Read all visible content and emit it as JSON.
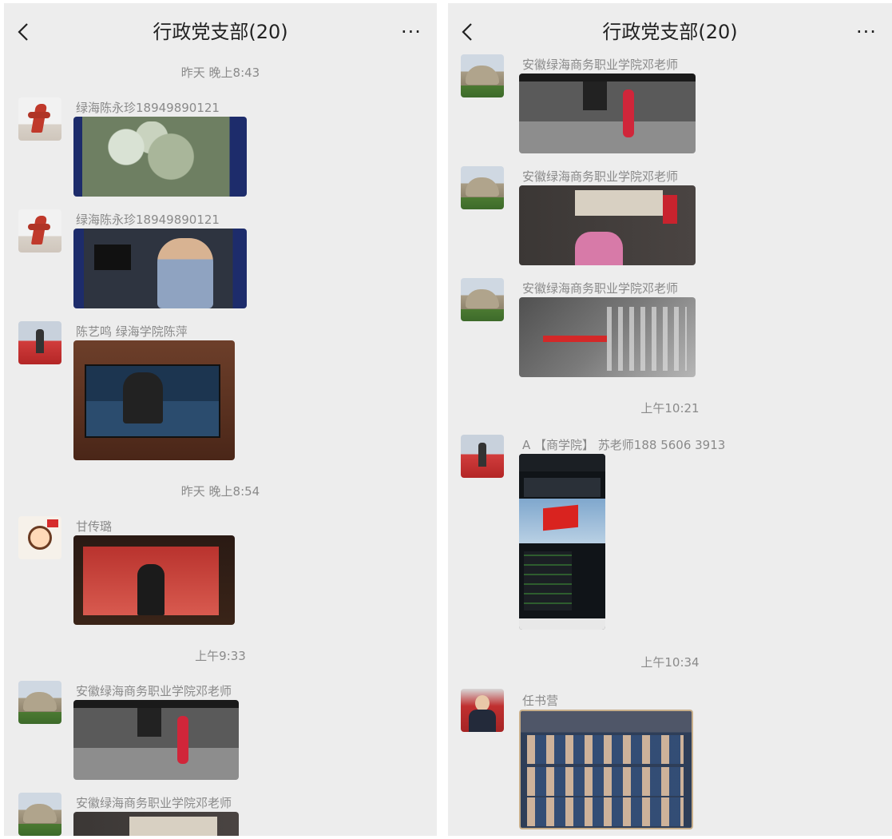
{
  "left": {
    "header": {
      "title": "行政党支部(20)",
      "more": "···"
    },
    "messages": [
      {
        "type": "time",
        "text": "昨天 晚上8:43"
      },
      {
        "type": "msg",
        "sender": "绿海陈永珍18949890121",
        "avatar": "sculpture-avatar",
        "media": "video-thumbnail"
      },
      {
        "type": "msg",
        "sender": "绿海陈永珍18949890121",
        "avatar": "sculpture-avatar",
        "media": "video-thumbnail"
      },
      {
        "type": "msg",
        "sender": "陈艺鸣 绿海学院陈萍",
        "avatar": "stage-avatar",
        "media": "photo"
      },
      {
        "type": "time",
        "text": "昨天 晚上8:54"
      },
      {
        "type": "msg",
        "sender": "甘传璐",
        "avatar": "cartoon-avatar",
        "media": "photo"
      },
      {
        "type": "time",
        "text": "上午9:33"
      },
      {
        "type": "msg",
        "sender": "安徽绿海商务职业学院邓老师",
        "avatar": "rock-avatar",
        "media": "video-thumbnail"
      },
      {
        "type": "msg",
        "sender": "安徽绿海商务职业学院邓老师",
        "avatar": "rock-avatar",
        "media": "video-thumbnail"
      }
    ]
  },
  "right": {
    "header": {
      "title": "行政党支部(20)",
      "more": "···"
    },
    "messages": [
      {
        "type": "msg",
        "sender": "安徽绿海商务职业学院邓老师",
        "avatar": "rock-avatar",
        "media": "video-thumbnail"
      },
      {
        "type": "msg",
        "sender": "安徽绿海商务职业学院邓老师",
        "avatar": "rock-avatar",
        "media": "video-thumbnail"
      },
      {
        "type": "msg",
        "sender": "安徽绿海商务职业学院邓老师",
        "avatar": "rock-avatar",
        "media": "video-thumbnail"
      },
      {
        "type": "time",
        "text": "上午10:21"
      },
      {
        "type": "msg",
        "sender": "A 【商学院】 苏老师188 5606 3913",
        "avatar": "stage-avatar",
        "media": "phone-screenshot"
      },
      {
        "type": "time",
        "text": "上午10:34"
      },
      {
        "type": "msg",
        "sender": "任书营",
        "avatar": "person-avatar",
        "media": "photo"
      }
    ]
  }
}
